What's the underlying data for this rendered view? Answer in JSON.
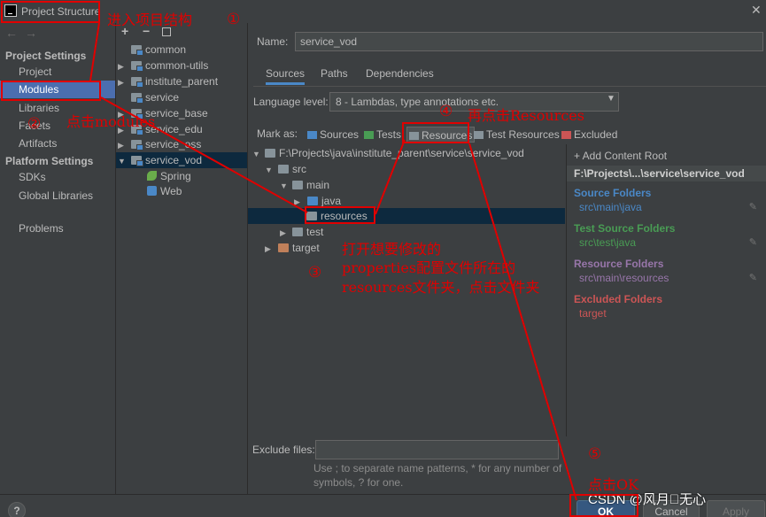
{
  "window": {
    "title": "Project Structure"
  },
  "nav": {
    "project_settings_header": "Project Settings",
    "project_settings": [
      "Project",
      "Modules",
      "Libraries",
      "Facets",
      "Artifacts"
    ],
    "platform_settings_header": "Platform Settings",
    "platform_settings": [
      "SDKs",
      "Global Libraries"
    ],
    "problems": "Problems",
    "selected": "Modules"
  },
  "modules": {
    "toolbar": {
      "add": "+",
      "remove": "−"
    },
    "items": [
      "common",
      "common-utils",
      "institute_parent",
      "service",
      "service_base",
      "service_edu",
      "service_oss",
      "service_vod",
      "Spring",
      "Web"
    ]
  },
  "module_detail": {
    "name_label": "Name:",
    "name_value": "service_vod",
    "tabs": [
      "Sources",
      "Paths",
      "Dependencies"
    ],
    "active_tab": "Sources",
    "language_level_label": "Language level:",
    "language_level_value": "8 - Lambdas, type annotations etc.",
    "mark_as_label": "Mark as:",
    "mark_as": [
      "Sources",
      "Tests",
      "Resources",
      "Test Resources",
      "Excluded"
    ],
    "tree": {
      "root": "F:\\Projects\\java\\institute_parent\\service\\service_vod",
      "src": "src",
      "main": "main",
      "java": "java",
      "resources": "resources",
      "test": "test",
      "target": "target"
    },
    "roots": {
      "add_content_root": "+ Add Content Root",
      "path": "F:\\Projects\\...\\service\\service_vod",
      "source_folders_label": "Source Folders",
      "source_folders_value": "src\\main\\java",
      "test_source_folders_label": "Test Source Folders",
      "test_source_folders_value": "src\\test\\java",
      "resource_folders_label": "Resource Folders",
      "resource_folders_value": "src\\main\\resources",
      "excluded_folders_label": "Excluded Folders",
      "excluded_folders_value": "target"
    },
    "exclude_files_label": "Exclude files:",
    "exclude_hint_1": "Use ; to separate name patterns, * for any number of",
    "exclude_hint_2": "symbols, ? for one."
  },
  "buttons": {
    "help": "?",
    "ok": "OK",
    "cancel": "Cancel",
    "apply": "Apply"
  },
  "watermark": "CSDN @风月\u0000无心",
  "annotations": {
    "step1": "进入项目结构",
    "num1": "①",
    "step2": "点击modules",
    "num2": "②",
    "step3_line1": "打开想要修改的",
    "step3_line2": "properties配置文件所在的",
    "step3_line3": "resources文件夹，点击文件夹",
    "num3": "③",
    "step4": "再点击Resources",
    "num4": "④",
    "step5": "点击OK",
    "num5": "⑤"
  },
  "colors": {
    "background": "#3c3f41",
    "selection": "#4b6eaf",
    "annotation": "#e00000",
    "source_folder": "#4a88c7",
    "test_folder": "#499c54",
    "resource_folder": "#9876aa",
    "excluded_folder": "#cc5555"
  }
}
